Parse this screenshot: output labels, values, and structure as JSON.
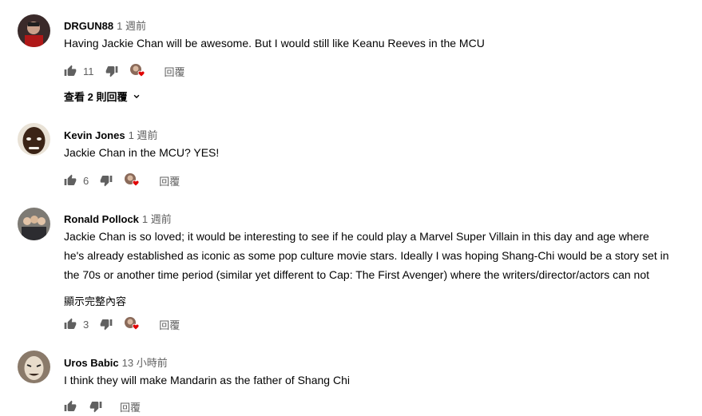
{
  "comments": [
    {
      "author": "DRGUN88",
      "time": "1 週前",
      "text": "Having Jackie Chan will be awesome. But I would still like Keanu Reeves in the MCU",
      "likes": "11",
      "reply_label": "回覆",
      "view_replies": "查看 2 則回覆"
    },
    {
      "author": "Kevin Jones",
      "time": "1 週前",
      "text": "Jackie Chan in the MCU? YES!",
      "likes": "6",
      "reply_label": "回覆"
    },
    {
      "author": "Ronald Pollock",
      "time": "1 週前",
      "text": "Jackie Chan is so loved; it would be interesting to see if he could play a Marvel Super Villain in this day and age where he's already established as iconic as some pop culture movie stars. Ideally I was hoping Shang-Chi would be a story set in the 70s or another time period (similar yet different to Cap: The First Avenger) where the writers/director/actors can not only",
      "show_more": "顯示完整內容",
      "likes": "3",
      "reply_label": "回覆"
    },
    {
      "author": "Uros Babic",
      "time": "13 小時前",
      "text": "I think they will make Mandarin as the father of Shang Chi",
      "reply_label": "回覆"
    }
  ],
  "icons": {
    "like": "thumb-up-icon",
    "dislike": "thumb-down-icon",
    "creator_heart": "creator-heart-icon",
    "chevron": "chevron-down-icon"
  },
  "colors": {
    "heart": "#e00000",
    "secondary_text": "#606060",
    "icon": "#909090"
  }
}
